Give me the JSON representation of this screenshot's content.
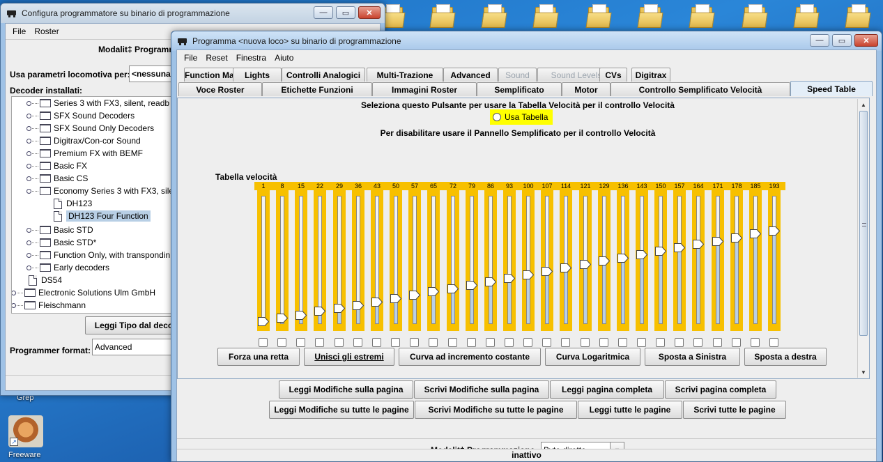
{
  "desktop": {
    "folder_count": 10,
    "shortcut_label": "Freeware",
    "partial_label": "Grep"
  },
  "back_window": {
    "title": "Configura programmatore su binario di programmazione",
    "menu": [
      "File",
      "Roster"
    ],
    "mode_label": "Modalit‡ Programm",
    "use_params_label": "Usa parametri locomotiva per:",
    "use_params_value": "<nessuna",
    "decoders_label": "Decoder installati:",
    "tree": [
      {
        "label": "Series 3 with FX3, silent, readb",
        "type": "folder",
        "level": 2
      },
      {
        "label": "SFX Sound Decoders",
        "type": "folder",
        "level": 2
      },
      {
        "label": "SFX Sound Only Decoders",
        "type": "folder",
        "level": 2
      },
      {
        "label": "Digitrax/Con-cor Sound",
        "type": "folder",
        "level": 2
      },
      {
        "label": "Premium FX with BEMF",
        "type": "folder",
        "level": 2
      },
      {
        "label": "Basic FX",
        "type": "folder",
        "level": 2
      },
      {
        "label": "Basic CS",
        "type": "folder",
        "level": 2
      },
      {
        "label": "Economy Series 3 with FX3, sile",
        "type": "folder",
        "level": 2
      },
      {
        "label": "DH123",
        "type": "leaf",
        "level": 3
      },
      {
        "label": "DH123 Four Function",
        "type": "leaf",
        "level": 3,
        "selected": true
      },
      {
        "label": "Basic STD",
        "type": "folder",
        "level": 2
      },
      {
        "label": "Basic STD*",
        "type": "folder",
        "level": 2
      },
      {
        "label": "Function Only, with transpondin",
        "type": "folder",
        "level": 2
      },
      {
        "label": "Early decoders",
        "type": "folder",
        "level": 2
      },
      {
        "label": "DS54",
        "type": "leaf",
        "level": 2
      },
      {
        "label": "Electronic Solutions Ulm GmbH",
        "type": "folder",
        "level": 1
      },
      {
        "label": "Fleischmann",
        "type": "folder",
        "level": 1
      }
    ],
    "read_type_button": "Leggi Tipo dal deco",
    "programmer_format_label": "Programmer format:",
    "programmer_format_value": "Advanced"
  },
  "front_window": {
    "title": "Programma <nuova loco> su binario di programmazione",
    "menu": [
      "File",
      "Reset",
      "Finestra",
      "Aiuto"
    ],
    "tabs_row1": [
      {
        "label": "Function Map",
        "disabled": false
      },
      {
        "label": "Lights",
        "disabled": false
      },
      {
        "label": "Controlli Analogici",
        "disabled": false
      },
      {
        "label": "Multi-Trazione",
        "disabled": false
      },
      {
        "label": "Advanced",
        "disabled": false
      },
      {
        "label": "Sound",
        "disabled": true
      },
      {
        "label": "Sound Levels",
        "disabled": true
      },
      {
        "label": "CVs",
        "disabled": false
      },
      {
        "label": "Digitrax",
        "disabled": false
      }
    ],
    "tabs_row2": [
      {
        "label": "Voce Roster"
      },
      {
        "label": "Etichette Funzioni"
      },
      {
        "label": "Immagini Roster"
      },
      {
        "label": "Semplificato"
      },
      {
        "label": "Motor"
      },
      {
        "label": "Controllo Semplificato Velocità"
      },
      {
        "label": "Speed Table",
        "active": true
      }
    ],
    "speed_panel": {
      "line1": "Seleziona questo Pulsante per usare la Tabella Velocità per il controllo Velocità",
      "radio_label": "Usa Tabella",
      "line2": "Per disabilitare usare il Pannello Semplificato per il controllo Velocità",
      "table_label": "Tabella velocità",
      "steps": [
        "1",
        "8",
        "15",
        "22",
        "29",
        "36",
        "43",
        "50",
        "57",
        "65",
        "72",
        "79",
        "86",
        "93",
        "100",
        "107",
        "114",
        "121",
        "129",
        "136",
        "143",
        "150",
        "157",
        "164",
        "171",
        "178",
        "185",
        "193"
      ],
      "slider_levels": [
        0.0,
        0.03,
        0.055,
        0.085,
        0.11,
        0.135,
        0.16,
        0.19,
        0.22,
        0.25,
        0.275,
        0.3,
        0.33,
        0.36,
        0.39,
        0.42,
        0.445,
        0.475,
        0.505,
        0.53,
        0.56,
        0.585,
        0.615,
        0.645,
        0.67,
        0.7,
        0.73,
        0.755
      ],
      "buttons": [
        "Forza una retta",
        "Unisci gli estremi",
        "Curva ad incremento costante",
        "Curva Logaritmica",
        "Sposta a Sinistra",
        "Sposta a destra"
      ]
    },
    "page_buttons": [
      "Leggi Modifiche sulla pagina",
      "Scrivi Modifiche sulla pagina",
      "Leggi pagina completa",
      "Scrivi pagina completa"
    ],
    "all_buttons": [
      "Leggi Modifiche su tutte le pagine",
      "Scrivi Modifiche su tutte le pagine",
      "Leggi tutte le pagine",
      "Scrivi tutte le pagine"
    ],
    "mode_label": "Modalit‡ Programmazione",
    "mode_value": "Byte diretto",
    "status": "inattivo"
  },
  "colors": {
    "slider_bg": "#f7c000",
    "radio_highlight": "#ffff00",
    "desktop_blue": "#2a86d8"
  }
}
